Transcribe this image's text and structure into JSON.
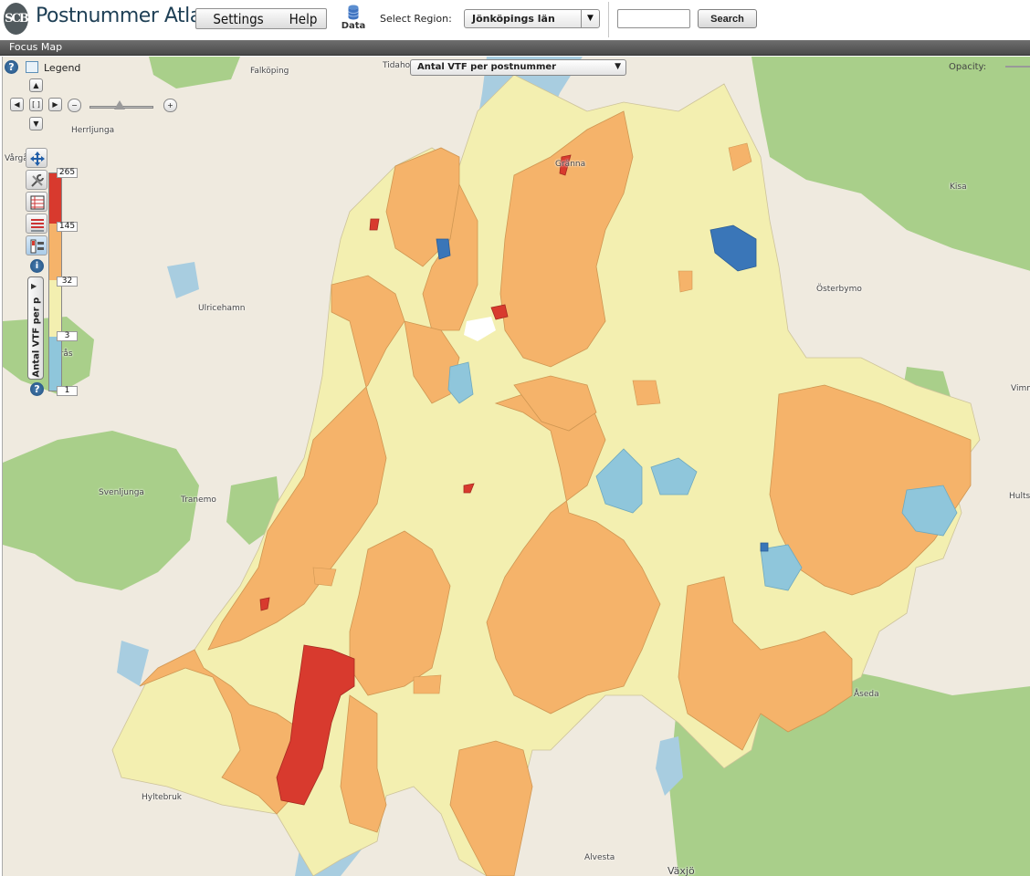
{
  "app": {
    "logo_text": "SCB",
    "title": "Postnummer Atlas"
  },
  "menu": {
    "settings": "Settings",
    "help": "Help",
    "data_label": "Data"
  },
  "region": {
    "label": "Select Region:",
    "value": "Jönköpings län"
  },
  "search": {
    "value": "",
    "button": "Search"
  },
  "panel": {
    "title": "Focus Map"
  },
  "map": {
    "legend_label": "Legend",
    "variable": "Antal VTF per postnummer",
    "layer_tab_label": "Antal VTF per p",
    "opacity_label": "Opacity:",
    "help_icon_text": "?",
    "info_icon_text": "i",
    "legend": {
      "breaks": [
        "265",
        "145",
        "32",
        "3",
        "1"
      ],
      "colors": [
        "#d83a2e",
        "#f5b36a",
        "#f3efb0",
        "#8fc6db",
        "#3a76b8"
      ]
    },
    "places": [
      "Falköping",
      "Herrljunga",
      "Vårgård",
      "Ulricehamn",
      "Borås",
      "Svenljunga",
      "Tranemo",
      "Hyltebruk",
      "Alvesta",
      "Växjö",
      "Åseda",
      "Hultsfred",
      "Vimmerby",
      "Österbymo",
      "Kisa",
      "Tidaholm",
      "Gränna"
    ]
  }
}
